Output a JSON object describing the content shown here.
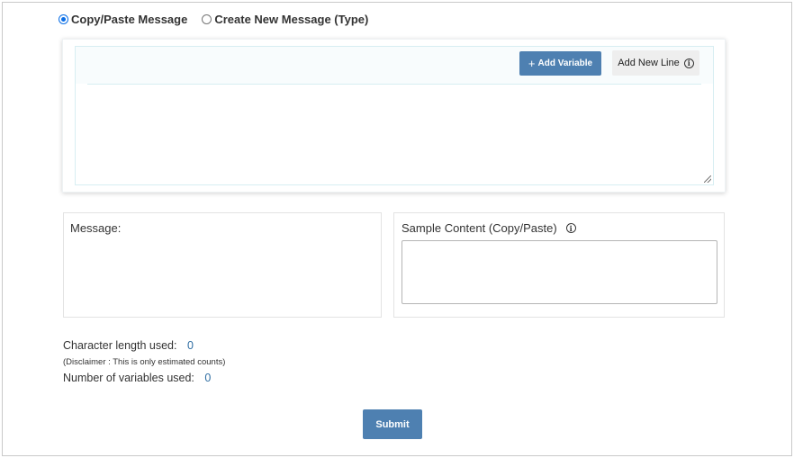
{
  "message_mode": {
    "options": [
      {
        "label": "Copy/Paste Message",
        "selected": true
      },
      {
        "label": "Create New Message (Type)",
        "selected": false
      }
    ]
  },
  "editor": {
    "add_variable_label": "Add Variable",
    "add_new_line_label": "Add New Line",
    "content": ""
  },
  "message_panel": {
    "label": "Message:",
    "content": ""
  },
  "sample_panel": {
    "label": "Sample Content (Copy/Paste)",
    "content": ""
  },
  "stats": {
    "char_length_label": "Character length used:",
    "char_length_value": "0",
    "disclaimer": "(Disclaimer : This is only estimated counts)",
    "variables_label": "Number of variables used:",
    "variables_value": "0"
  },
  "submit_label": "Submit",
  "colors": {
    "primary_button": "#4e80b1",
    "link_value": "#2f6ea3",
    "radio_checked": "#0a6ee6"
  }
}
